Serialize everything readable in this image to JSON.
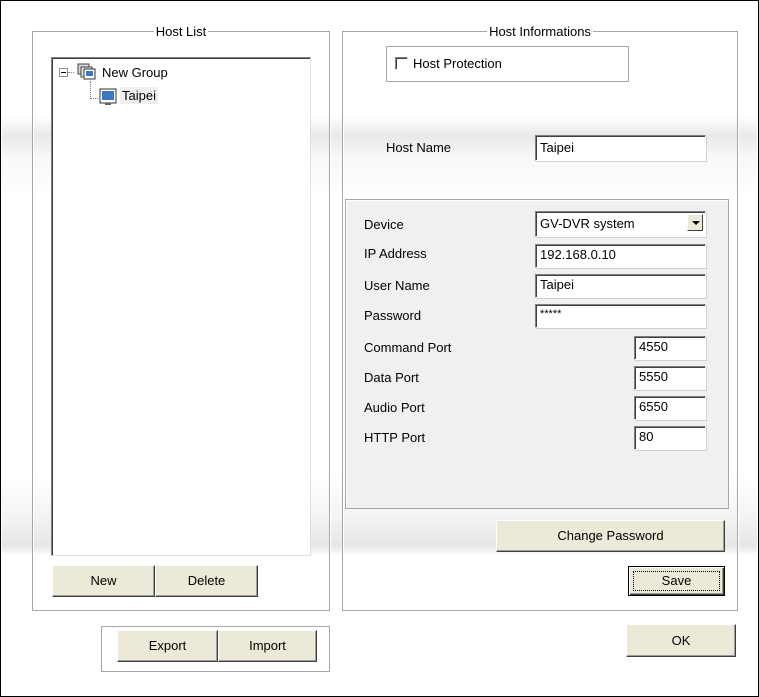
{
  "host_list": {
    "title": "Host List",
    "tree": {
      "group_label": "New Group",
      "host_label": "Taipei"
    },
    "new_label": "New",
    "delete_label": "Delete"
  },
  "host_info": {
    "title": "Host Informations",
    "host_protection_label": "Host Protection",
    "host_protection_checked": false,
    "host_name_label": "Host Name",
    "host_name_value": "Taipei",
    "device_label": "Device",
    "device_value": "GV-DVR system",
    "ip_label": "IP Address",
    "ip_value": "192.168.0.10",
    "user_label": "User Name",
    "user_value": "Taipei",
    "password_label": "Password",
    "password_value": "*****",
    "command_port_label": "Command Port",
    "command_port_value": "4550",
    "data_port_label": "Data Port",
    "data_port_value": "5550",
    "audio_port_label": "Audio Port",
    "audio_port_value": "6550",
    "http_port_label": "HTTP Port",
    "http_port_value": "80",
    "change_password_label": "Change Password",
    "save_label": "Save"
  },
  "bottom": {
    "export_label": "Export",
    "import_label": "Import",
    "ok_label": "OK"
  },
  "icons": {
    "group": "group-monitor-icon",
    "host": "host-monitor-icon",
    "expander": "collapse-icon",
    "dropdown": "chevron-down-icon"
  }
}
